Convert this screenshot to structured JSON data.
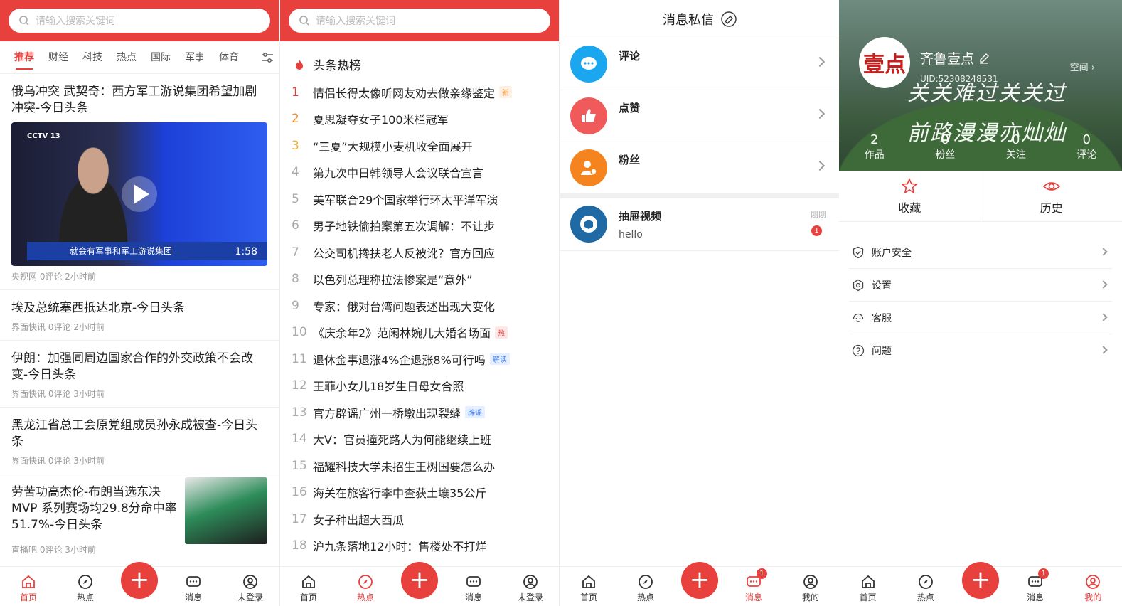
{
  "search_placeholder": "请输入搜索关键词",
  "home": {
    "tabs": [
      "推荐",
      "财经",
      "科技",
      "热点",
      "国际",
      "军事",
      "体育"
    ],
    "news": [
      {
        "title": "俄乌冲突 武契奇：西方军工游说集团希望加剧冲突-今日头条",
        "meta": "央视网 0评论 2小时前",
        "video_bar": "就会有军事和军工游说集团",
        "duration": "1:58"
      },
      {
        "title": "埃及总统塞西抵达北京-今日头条",
        "meta": "界面快讯 0评论 2小时前"
      },
      {
        "title": "伊朗：加强同周边国家合作的外交政策不会改变-今日头条",
        "meta": "界面快讯 0评论 3小时前"
      },
      {
        "title": "黑龙江省总工会原党组成员孙永成被查-今日头条",
        "meta": "界面快讯 0评论 3小时前"
      },
      {
        "title": "劳苦功高杰伦-布朗当选东决MVP 系列赛场均29.8分命中率51.7%-今日头条",
        "meta": "直播吧 0评论 3小时前"
      }
    ]
  },
  "hot": {
    "title": "头条热榜",
    "items": [
      {
        "n": "1",
        "t": "情侣长得太像听网友劝去做亲缘鉴定",
        "tag": "新",
        "tagtype": "new"
      },
      {
        "n": "2",
        "t": "夏思凝夺女子100米栏冠军",
        "tag": "",
        "tagtype": ""
      },
      {
        "n": "3",
        "t": "“三夏”大规模小麦机收全面展开",
        "tag": "",
        "tagtype": ""
      },
      {
        "n": "4",
        "t": "第九次中日韩领导人会议联合宣言",
        "tag": "",
        "tagtype": ""
      },
      {
        "n": "5",
        "t": "美军联合29个国家举行环太平洋军演",
        "tag": "",
        "tagtype": ""
      },
      {
        "n": "6",
        "t": "男子地铁偷拍案第五次调解：不让步",
        "tag": "",
        "tagtype": ""
      },
      {
        "n": "7",
        "t": "公交司机搀扶老人反被讹？官方回应",
        "tag": "",
        "tagtype": ""
      },
      {
        "n": "8",
        "t": "以色列总理称拉法惨案是“意外”",
        "tag": "",
        "tagtype": ""
      },
      {
        "n": "9",
        "t": "专家：俄对台湾问题表述出现大变化",
        "tag": "",
        "tagtype": ""
      },
      {
        "n": "10",
        "t": "《庆余年2》范闲林婉儿大婚名场面",
        "tag": "热",
        "tagtype": "hot"
      },
      {
        "n": "11",
        "t": "退休金事退涨4%企退涨8%可行吗",
        "tag": "解读",
        "tagtype": "info"
      },
      {
        "n": "12",
        "t": "王菲小女儿18岁生日母女合照",
        "tag": "",
        "tagtype": ""
      },
      {
        "n": "13",
        "t": "官方辟谣广州一桥墩出现裂缝",
        "tag": "辟谣",
        "tagtype": "info"
      },
      {
        "n": "14",
        "t": "大V：官员撞死路人为何能继续上班",
        "tag": "",
        "tagtype": ""
      },
      {
        "n": "15",
        "t": "福耀科技大学未招生王树国要怎么办",
        "tag": "",
        "tagtype": ""
      },
      {
        "n": "16",
        "t": "海关在旅客行李中查获土壤35公斤",
        "tag": "",
        "tagtype": ""
      },
      {
        "n": "17",
        "t": "女子种出超大西瓜",
        "tag": "",
        "tagtype": ""
      },
      {
        "n": "18",
        "t": "沪九条落地12小时：售楼处不打烊",
        "tag": "",
        "tagtype": ""
      }
    ]
  },
  "msg": {
    "title": "消息私信",
    "rows": [
      "评论",
      "点赞",
      "粉丝"
    ],
    "chat": {
      "name": "抽屉视频",
      "text": "hello",
      "time": "刚刚",
      "badge": "1"
    }
  },
  "profile": {
    "avatar_text": "壹点",
    "name": "齐鲁壹点",
    "uid": "UID:52308248531",
    "space": "空间 ›",
    "motto": "关关难过关关过 前路漫漫亦灿灿",
    "stats": [
      {
        "v": "2",
        "l": "作品"
      },
      {
        "v": "0",
        "l": "粉丝"
      },
      {
        "v": "0",
        "l": "关注"
      },
      {
        "v": "0",
        "l": "评论"
      }
    ],
    "fav": "收藏",
    "history": "历史",
    "settings": [
      "账户安全",
      "设置",
      "客服",
      "问题"
    ]
  },
  "nav": {
    "home": "首页",
    "hot": "热点",
    "msg": "消息",
    "guest": "未登录",
    "me": "我的",
    "plus": "+",
    "badge": "1"
  },
  "colors": {
    "accent": "#e8403d"
  }
}
